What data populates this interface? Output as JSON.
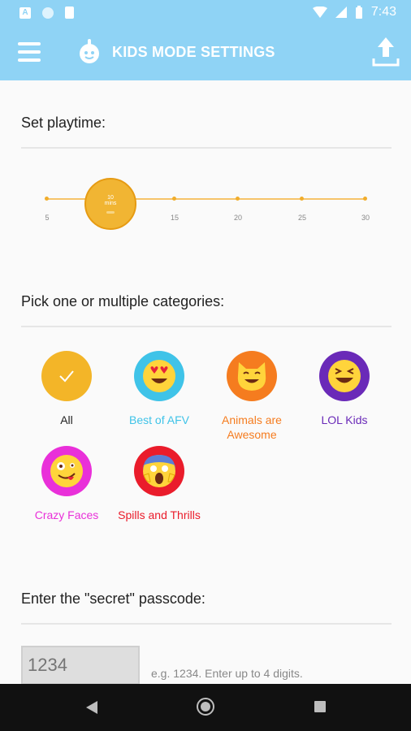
{
  "status_bar": {
    "time": "7:43"
  },
  "app_bar": {
    "title": "KIDS MODE SETTINGS"
  },
  "playtime": {
    "heading": "Set playtime:",
    "ticks": [
      "5",
      "15",
      "20",
      "25",
      "30"
    ],
    "selected_value_line1": "10",
    "selected_value_line2": "mins",
    "selected_minutes": 10
  },
  "categories": {
    "heading": "Pick one or multiple categories:",
    "items": [
      {
        "label": "All",
        "color": "#222222",
        "circle_color": "#f3b528",
        "icon": "check-icon"
      },
      {
        "label": "Best of AFV",
        "color": "#3fc3e8",
        "circle_color": "#3fc3e8",
        "icon": "heart-eyes-emoji-icon"
      },
      {
        "label_line1": "Animals are",
        "label_line2": "Awesome",
        "color": "#f57c1f",
        "circle_color": "#f57c1f",
        "icon": "cat-emoji-icon"
      },
      {
        "label": "LOL Kids",
        "color": "#6a2ab8",
        "circle_color": "#6a2ab8",
        "icon": "laughing-emoji-icon"
      },
      {
        "label": "Crazy Faces",
        "color": "#e930d9",
        "circle_color": "#e930d9",
        "icon": "crazy-face-emoji-icon"
      },
      {
        "label": "Spills and Thrills",
        "color": "#ea1c2b",
        "circle_color": "#ea1c2b",
        "icon": "scream-emoji-icon"
      }
    ]
  },
  "passcode": {
    "heading": "Enter the \"secret\" passcode:",
    "placeholder": "1234",
    "hint": "e.g. 1234. Enter up to 4 digits."
  }
}
